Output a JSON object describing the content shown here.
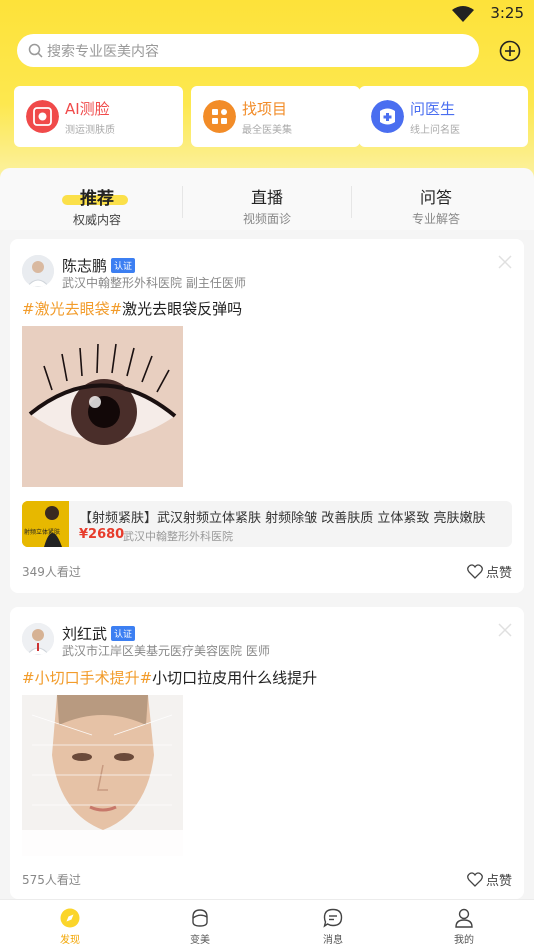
{
  "status_bar": {
    "time": "3:25"
  },
  "search": {
    "placeholder": "搜索专业医美内容"
  },
  "quick_links": [
    {
      "title": "AI测脸",
      "subtitle": "测运测肤质",
      "color": "#f04a4a"
    },
    {
      "title": "找项目",
      "subtitle": "最全医美集",
      "color": "#f28c28"
    },
    {
      "title": "问医生",
      "subtitle": "线上问名医",
      "color": "#4a6ef0"
    }
  ],
  "tabs": [
    {
      "label": "推荐",
      "sub": "权威内容",
      "active": true
    },
    {
      "label": "直播",
      "sub": "视频面诊",
      "active": false
    },
    {
      "label": "问答",
      "sub": "专业解答",
      "active": false
    }
  ],
  "posts": [
    {
      "doctor_name": "陈志鹏",
      "verified": "认证",
      "hospital": "武汉中翰整形外科医院 副主任医师",
      "hashtag": "#激光去眼袋#",
      "title": "激光去眼袋反弹吗",
      "product": {
        "name": "【射频紧肤】武汉射频立体紧肤 射频除皱 改善肤质 立体紧致 亮肤嫩肤",
        "price": "¥2680",
        "hospital": "武汉中翰整形外科医院",
        "thumb_text": "射频立体紧肤"
      },
      "views": "349人看过",
      "like": "点赞"
    },
    {
      "doctor_name": "刘红武",
      "verified": "认证",
      "hospital": "武汉市江岸区美基元医疗美容医院 医师",
      "hashtag": "#小切口手术提升#",
      "title": "小切口拉皮用什么线提升",
      "views": "575人看过",
      "like": "点赞"
    }
  ],
  "bottom_nav": [
    {
      "label": "发现",
      "icon": "compass-icon",
      "active": true
    },
    {
      "label": "变美",
      "icon": "face-icon",
      "active": false
    },
    {
      "label": "消息",
      "icon": "chat-icon",
      "active": false
    },
    {
      "label": "我的",
      "icon": "user-icon",
      "active": false
    }
  ],
  "colors": {
    "accent": "#fde23a",
    "hashtag": "#f29c2b",
    "price": "#e73c2c",
    "verified": "#3c7ff2",
    "nav_active": "#f2a500"
  }
}
